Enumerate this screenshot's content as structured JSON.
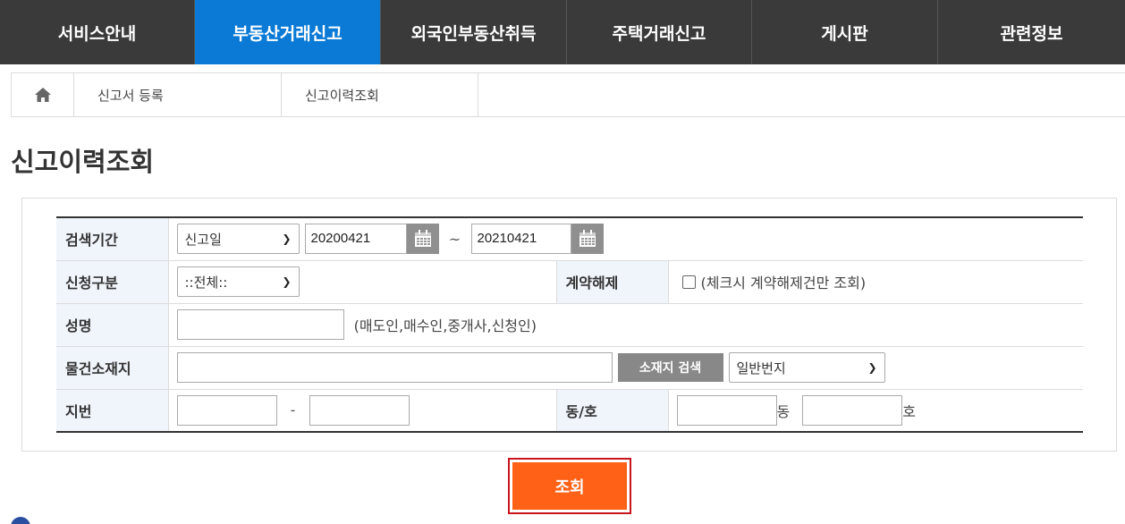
{
  "nav": {
    "items": [
      {
        "label": "서비스안내"
      },
      {
        "label": "부동산거래신고"
      },
      {
        "label": "외국인부동산취득"
      },
      {
        "label": "주택거래신고"
      },
      {
        "label": "게시판"
      },
      {
        "label": "관련정보"
      }
    ],
    "active_index": 1,
    "active_color": "#0a7ad6"
  },
  "breadcrumb": {
    "home_icon": "home-icon",
    "items": [
      {
        "label": "신고서 등록"
      },
      {
        "label": "신고이력조회"
      }
    ]
  },
  "page": {
    "title": "신고이력조회"
  },
  "search": {
    "period": {
      "label": "검색기간",
      "type_selected": "신고일",
      "start": "20200421",
      "separator": "~",
      "end": "20210421",
      "calendar_icon": "calendar-icon"
    },
    "request_type": {
      "label": "신청구분",
      "selected": "::전체::"
    },
    "cancel": {
      "label": "계약해제",
      "checkbox_text": "(체크시 계약해제건만 조회)",
      "checked": false
    },
    "name": {
      "label": "성명",
      "value": "",
      "hint": "(매도인,매수인,중개사,신청인)"
    },
    "location": {
      "label": "물건소재지",
      "value": "",
      "search_button": "소재지 검색",
      "lot_type_selected": "일반번지"
    },
    "lot": {
      "label": "지번",
      "main": "",
      "dash": "-",
      "sub": ""
    },
    "unit": {
      "label": "동/호",
      "dong": "",
      "dong_suffix": "동",
      "ho": "",
      "ho_suffix": "호"
    }
  },
  "submit": {
    "label": "조회",
    "color": "#ff6116"
  }
}
